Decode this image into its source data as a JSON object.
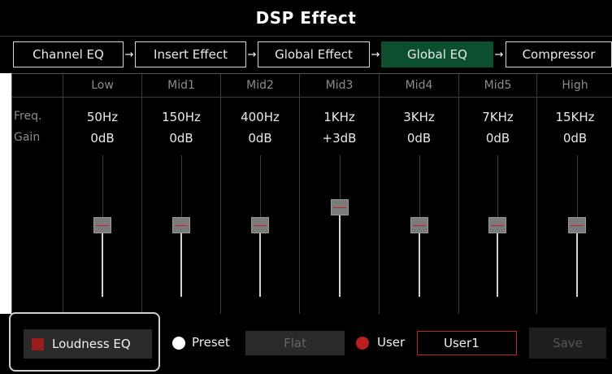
{
  "title": "DSP Effect",
  "tabs": [
    {
      "label": "Channel EQ",
      "active": false
    },
    {
      "label": "Insert Effect",
      "active": false
    },
    {
      "label": "Global Effect",
      "active": false
    },
    {
      "label": "Global EQ",
      "active": true
    },
    {
      "label": "Compressor",
      "active": false
    }
  ],
  "tab_arrow": "→",
  "row_labels": {
    "freq": "Freq.",
    "gain": "Gain"
  },
  "bands": [
    {
      "name": "Low",
      "freq": "50Hz",
      "gain": "0dB"
    },
    {
      "name": "Mid1",
      "freq": "150Hz",
      "gain": "0dB"
    },
    {
      "name": "Mid2",
      "freq": "400Hz",
      "gain": "0dB"
    },
    {
      "name": "Mid3",
      "freq": "1KHz",
      "gain": "+3dB"
    },
    {
      "name": "Mid4",
      "freq": "3KHz",
      "gain": "0dB"
    },
    {
      "name": "Mid5",
      "freq": "7KHz",
      "gain": "0dB"
    },
    {
      "name": "High",
      "freq": "15KHz",
      "gain": "0dB"
    }
  ],
  "bottom": {
    "loudness_label": "Loudness EQ",
    "preset_label": "Preset",
    "preset_value": "Flat",
    "user_label": "User",
    "user_value": "User1",
    "save_label": "Save"
  },
  "colors": {
    "active_tab": "#0c4f2e",
    "accent_red": "#c2202a",
    "checkbox_red": "#9c1c1c",
    "preset_radio": "#ffffff",
    "user_radio": "#b81e1e"
  }
}
